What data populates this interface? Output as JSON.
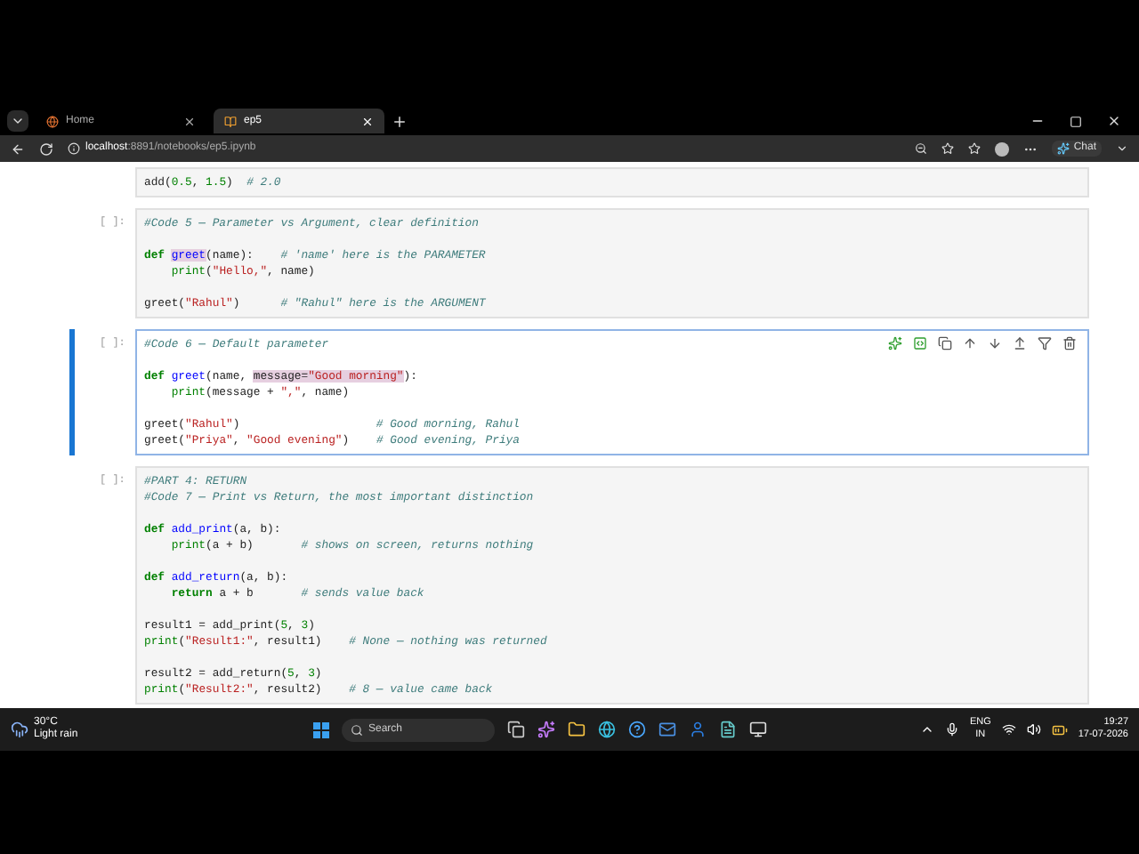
{
  "browser": {
    "tabs": [
      {
        "label": "Home",
        "selected": false
      },
      {
        "label": "ep5",
        "selected": true
      }
    ],
    "url_host": "localhost",
    "url_path": ":8891/notebooks/ep5.ipynb",
    "chat_label": "Chat"
  },
  "cells": [
    {
      "selected": false,
      "blocks": [
        [
          [
            {
              "kind": "plain",
              "text": "add("
            },
            {
              "kind": "number",
              "text": "0.5"
            },
            {
              "kind": "plain",
              "text": ", "
            },
            {
              "kind": "number",
              "text": "1.5"
            },
            {
              "kind": "plain",
              "text": ")  "
            },
            {
              "kind": "comment",
              "text": "# 2.0"
            }
          ]
        ]
      ]
    },
    {
      "prompt": "[ ]:",
      "selected": false,
      "blocks": [
        [
          [
            {
              "kind": "comment",
              "text": "#Code 5 — Parameter vs Argument, clear definition"
            }
          ]
        ],
        [
          [
            {
              "kind": "keyword",
              "text": "def "
            },
            {
              "kind": "def_name",
              "text": "greet",
              "highlighted": true
            },
            {
              "kind": "plain",
              "text": "(name):    "
            },
            {
              "kind": "comment",
              "text": "# 'name' here is the PARAMETER"
            }
          ],
          [
            {
              "kind": "builtin",
              "text": "    print"
            },
            {
              "kind": "plain",
              "text": "("
            },
            {
              "kind": "string",
              "text": "\"Hello,\""
            },
            {
              "kind": "plain",
              "text": ", name)"
            }
          ]
        ],
        [
          [
            {
              "kind": "plain",
              "text": "greet("
            },
            {
              "kind": "string",
              "text": "\"Rahul\""
            },
            {
              "kind": "plain",
              "text": ")      "
            },
            {
              "kind": "comment",
              "text": "# \"Rahul\" here is the ARGUMENT"
            }
          ]
        ]
      ]
    },
    {
      "prompt": "[ ]:",
      "selected": true,
      "blocks": [
        [
          [
            {
              "kind": "comment",
              "text": "#Code 6 — Default parameter"
            }
          ]
        ],
        [
          [
            {
              "kind": "keyword",
              "text": "def "
            },
            {
              "kind": "def_name",
              "text": "greet"
            },
            {
              "kind": "plain",
              "text": "(name, "
            },
            {
              "kind": "plain",
              "text": "message=",
              "highlighted": true
            },
            {
              "kind": "string",
              "text": "\"Good morning\"",
              "highlighted": true
            },
            {
              "kind": "plain",
              "text": "):"
            }
          ],
          [
            {
              "kind": "builtin",
              "text": "    print"
            },
            {
              "kind": "plain",
              "text": "(message + "
            },
            {
              "kind": "string",
              "text": "\",\""
            },
            {
              "kind": "plain",
              "text": ", name)"
            }
          ]
        ],
        [
          [
            {
              "kind": "plain",
              "text": "greet("
            },
            {
              "kind": "string",
              "text": "\"Rahul\""
            },
            {
              "kind": "plain",
              "text": ")                    "
            },
            {
              "kind": "comment",
              "text": "# Good morning, Rahul"
            }
          ],
          [
            {
              "kind": "plain",
              "text": "greet("
            },
            {
              "kind": "string",
              "text": "\"Priya\""
            },
            {
              "kind": "plain",
              "text": ", "
            },
            {
              "kind": "string",
              "text": "\"Good evening\""
            },
            {
              "kind": "plain",
              "text": ")    "
            },
            {
              "kind": "comment",
              "text": "# Good evening, Priya"
            }
          ]
        ]
      ]
    },
    {
      "prompt": "[ ]:",
      "selected": false,
      "blocks": [
        [
          [
            {
              "kind": "comment",
              "text": "#PART 4: RETURN"
            }
          ],
          [
            {
              "kind": "comment",
              "text": "#Code 7 — Print vs Return, the most important distinction"
            }
          ]
        ],
        [
          [
            {
              "kind": "keyword",
              "text": "def "
            },
            {
              "kind": "def_name",
              "text": "add_print"
            },
            {
              "kind": "plain",
              "text": "(a, b):"
            }
          ],
          [
            {
              "kind": "builtin",
              "text": "    print"
            },
            {
              "kind": "plain",
              "text": "(a + b)       "
            },
            {
              "kind": "comment",
              "text": "# shows on screen, returns nothing"
            }
          ]
        ],
        [
          [
            {
              "kind": "keyword",
              "text": "def "
            },
            {
              "kind": "def_name",
              "text": "add_return"
            },
            {
              "kind": "plain",
              "text": "(a, b):"
            }
          ],
          [
            {
              "kind": "keyword",
              "text": "    return"
            },
            {
              "kind": "plain",
              "text": " a + b       "
            },
            {
              "kind": "comment",
              "text": "# sends value back"
            }
          ]
        ],
        [
          [
            {
              "kind": "plain",
              "text": "result1 = add_print("
            },
            {
              "kind": "number",
              "text": "5"
            },
            {
              "kind": "plain",
              "text": ", "
            },
            {
              "kind": "number",
              "text": "3"
            },
            {
              "kind": "plain",
              "text": ")"
            }
          ],
          [
            {
              "kind": "builtin",
              "text": "print"
            },
            {
              "kind": "plain",
              "text": "("
            },
            {
              "kind": "string",
              "text": "\"Result1:\""
            },
            {
              "kind": "plain",
              "text": ", result1)    "
            },
            {
              "kind": "comment",
              "text": "# None — nothing was returned"
            }
          ]
        ],
        [
          [
            {
              "kind": "plain",
              "text": "result2 = add_return("
            },
            {
              "kind": "number",
              "text": "5"
            },
            {
              "kind": "plain",
              "text": ", "
            },
            {
              "kind": "number",
              "text": "3"
            },
            {
              "kind": "plain",
              "text": ")"
            }
          ],
          [
            {
              "kind": "builtin",
              "text": "print"
            },
            {
              "kind": "plain",
              "text": "("
            },
            {
              "kind": "string",
              "text": "\"Result2:\""
            },
            {
              "kind": "plain",
              "text": ", result2)    "
            },
            {
              "kind": "comment",
              "text": "# 8 — value came back"
            }
          ]
        ]
      ]
    }
  ],
  "taskbar": {
    "weather_temp": "30°C",
    "weather_text": "Light rain",
    "search_placeholder": "Search",
    "language": "ENG",
    "region": "IN",
    "time": "19:27",
    "date": "17-07-2026"
  }
}
